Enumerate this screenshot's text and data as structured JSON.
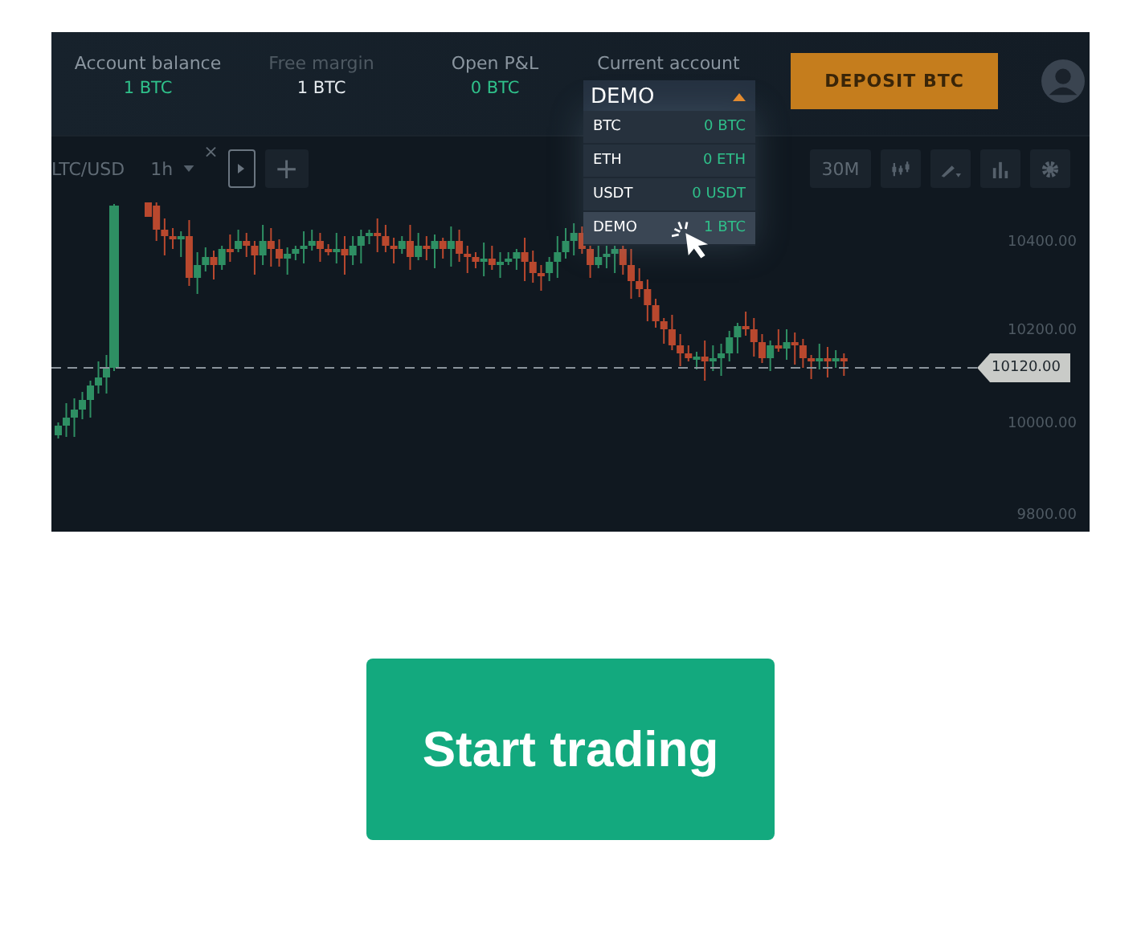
{
  "header": {
    "stats": [
      {
        "label": "Account balance",
        "value": "1 BTC",
        "color": "#2fc08a"
      },
      {
        "label": "Free margin",
        "value": "1 BTC",
        "color": "#e6ebef"
      },
      {
        "label": "Open P&L",
        "value": "0 BTC",
        "color": "#2fc08a"
      }
    ],
    "account": {
      "label": "Current account",
      "value": "DEMO",
      "expanded": true,
      "options": [
        {
          "name": "BTC",
          "amount": "0 BTC",
          "selected": false
        },
        {
          "name": "ETH",
          "amount": "0 ETH",
          "selected": false
        },
        {
          "name": "USDT",
          "amount": "0 USDT",
          "selected": false
        },
        {
          "name": "DEMO",
          "amount": "1 BTC",
          "selected": true
        }
      ]
    },
    "deposit_button": "DEPOSIT BTC"
  },
  "toolbar": {
    "symbol": "LTC/USD",
    "interval": "1h",
    "close": "×",
    "add": "+",
    "timeframe": "30M"
  },
  "chart": {
    "price_labels": [
      "10400.00",
      "10200.00",
      "10000.00",
      "9800.00"
    ],
    "current_price": "10120.00"
  },
  "cta_button": "Start trading"
}
